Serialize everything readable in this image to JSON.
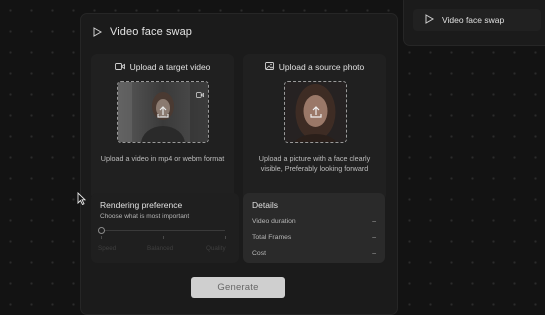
{
  "main_panel": {
    "title": "Video face swap",
    "upload_video": {
      "title": "Upload a target video",
      "description": "Upload a video in mp4 or webm format"
    },
    "upload_photo": {
      "title": "Upload a source photo",
      "description": "Upload a picture with a face clearly visible, Preferably looking forward"
    },
    "rendering": {
      "title": "Rendering preference",
      "subtitle": "Choose what is most important",
      "options": [
        "Speed",
        "Balanced",
        "Quality"
      ],
      "selected": "Speed"
    },
    "details": {
      "title": "Details",
      "rows": [
        {
          "label": "Video duration",
          "value": "–"
        },
        {
          "label": "Total Frames",
          "value": "–"
        },
        {
          "label": "Cost",
          "value": "–"
        }
      ]
    },
    "generate_label": "Generate"
  },
  "right_panel": {
    "item_label": "Video face swap"
  },
  "icons": [
    "play-icon",
    "video-camera-icon",
    "image-icon",
    "upload-icon",
    "mouse-cursor-icon"
  ],
  "colors": {
    "background": "#131313",
    "panel": "#1b1b1b",
    "card": "#202020",
    "details_card": "#2a2a2a",
    "generate_button": "#cfcfcf"
  }
}
